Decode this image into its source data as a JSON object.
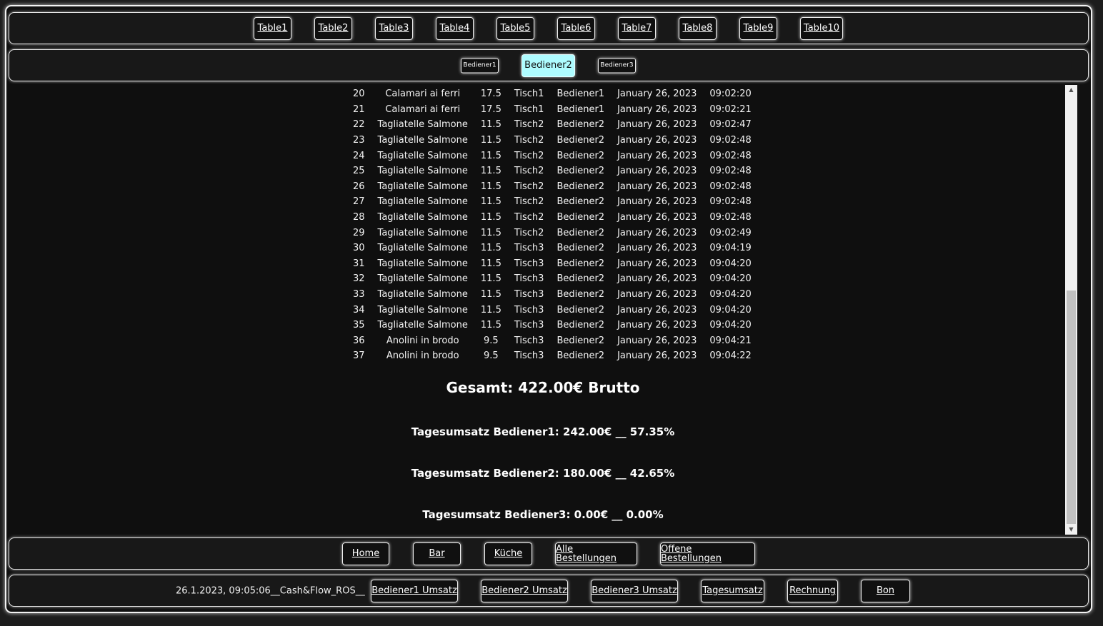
{
  "tables": [
    "Table1",
    "Table2",
    "Table3",
    "Table4",
    "Table5",
    "Table6",
    "Table7",
    "Table8",
    "Table9",
    "Table10"
  ],
  "waiters": [
    "Bediener1",
    "Bediener2",
    "Bediener3"
  ],
  "active_waiter": "Bediener2",
  "orders": [
    [
      "20",
      "Calamari ai ferri",
      "17.5",
      "Tisch1",
      "Bediener1",
      "January 26, 2023",
      "09:02:20"
    ],
    [
      "21",
      "Calamari ai ferri",
      "17.5",
      "Tisch1",
      "Bediener1",
      "January 26, 2023",
      "09:02:21"
    ],
    [
      "22",
      "Tagliatelle Salmone",
      "11.5",
      "Tisch2",
      "Bediener2",
      "January 26, 2023",
      "09:02:47"
    ],
    [
      "23",
      "Tagliatelle Salmone",
      "11.5",
      "Tisch2",
      "Bediener2",
      "January 26, 2023",
      "09:02:48"
    ],
    [
      "24",
      "Tagliatelle Salmone",
      "11.5",
      "Tisch2",
      "Bediener2",
      "January 26, 2023",
      "09:02:48"
    ],
    [
      "25",
      "Tagliatelle Salmone",
      "11.5",
      "Tisch2",
      "Bediener2",
      "January 26, 2023",
      "09:02:48"
    ],
    [
      "26",
      "Tagliatelle Salmone",
      "11.5",
      "Tisch2",
      "Bediener2",
      "January 26, 2023",
      "09:02:48"
    ],
    [
      "27",
      "Tagliatelle Salmone",
      "11.5",
      "Tisch2",
      "Bediener2",
      "January 26, 2023",
      "09:02:48"
    ],
    [
      "28",
      "Tagliatelle Salmone",
      "11.5",
      "Tisch2",
      "Bediener2",
      "January 26, 2023",
      "09:02:48"
    ],
    [
      "29",
      "Tagliatelle Salmone",
      "11.5",
      "Tisch2",
      "Bediener2",
      "January 26, 2023",
      "09:02:49"
    ],
    [
      "30",
      "Tagliatelle Salmone",
      "11.5",
      "Tisch3",
      "Bediener2",
      "January 26, 2023",
      "09:04:19"
    ],
    [
      "31",
      "Tagliatelle Salmone",
      "11.5",
      "Tisch3",
      "Bediener2",
      "January 26, 2023",
      "09:04:20"
    ],
    [
      "32",
      "Tagliatelle Salmone",
      "11.5",
      "Tisch3",
      "Bediener2",
      "January 26, 2023",
      "09:04:20"
    ],
    [
      "33",
      "Tagliatelle Salmone",
      "11.5",
      "Tisch3",
      "Bediener2",
      "January 26, 2023",
      "09:04:20"
    ],
    [
      "34",
      "Tagliatelle Salmone",
      "11.5",
      "Tisch3",
      "Bediener2",
      "January 26, 2023",
      "09:04:20"
    ],
    [
      "35",
      "Tagliatelle Salmone",
      "11.5",
      "Tisch3",
      "Bediener2",
      "January 26, 2023",
      "09:04:20"
    ],
    [
      "36",
      "Anolini in brodo",
      "9.5",
      "Tisch3",
      "Bediener2",
      "January 26, 2023",
      "09:04:21"
    ],
    [
      "37",
      "Anolini in brodo",
      "9.5",
      "Tisch3",
      "Bediener2",
      "January 26, 2023",
      "09:04:22"
    ]
  ],
  "summary": {
    "total": "Gesamt: 422.00€ Brutto",
    "bediener1": "Tagesumsatz Bediener1: 242.00€ __ 57.35%",
    "bediener2": "Tagesumsatz Bediener2: 180.00€ __ 42.65%",
    "bediener3": "Tagesumsatz Bediener3: 0.00€ __ 0.00%"
  },
  "nav": [
    "Home",
    "Bar",
    "Küche",
    "Alle Bestellungen",
    "Offene Bestellungen"
  ],
  "footer": {
    "status": "26.1.2023, 09:05:06__Cash&Flow_ROS__",
    "buttons": [
      "Bediener1 Umsatz",
      "Bediener2 Umsatz",
      "Bediener3 Umsatz",
      "Tagesumsatz",
      "Rechnung",
      "Bon"
    ]
  },
  "colors": {
    "active_button": "#aefcff",
    "background": "#111111",
    "border": "#f0f0f0"
  }
}
